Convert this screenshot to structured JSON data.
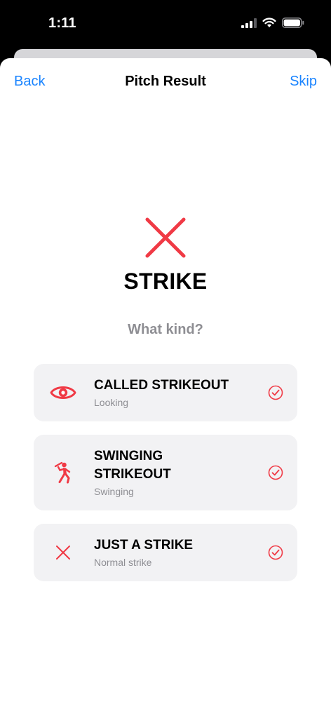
{
  "status_bar": {
    "time": "1:11"
  },
  "nav": {
    "back_label": "Back",
    "title": "Pitch Result",
    "skip_label": "Skip"
  },
  "result": {
    "icon": "x-mark-icon",
    "title": "STRIKE",
    "prompt": "What kind?"
  },
  "options": [
    {
      "icon": "eye-icon",
      "title": "CALLED STRIKEOUT",
      "description": "Looking"
    },
    {
      "icon": "batter-swing-icon",
      "title": " SWINGING\nSTRIKEOUT",
      "description": "Swinging"
    },
    {
      "icon": "x-mark-icon",
      "title": "JUST A STRIKE",
      "description": "Normal strike"
    }
  ],
  "colors": {
    "accent_red": "#f03a45",
    "link_blue": "#1a84ff",
    "card_bg": "#f2f2f4",
    "secondary_text": "#8e8e93"
  }
}
